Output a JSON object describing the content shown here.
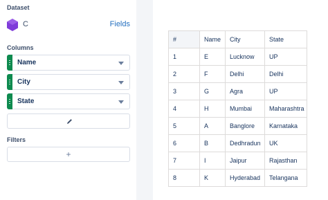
{
  "sidebar": {
    "dataset_label": "Dataset",
    "dataset_name": "C",
    "fields_link": "Fields",
    "columns_label": "Columns",
    "columns": [
      {
        "label": "Name"
      },
      {
        "label": "City"
      },
      {
        "label": "State"
      }
    ],
    "filters_label": "Filters",
    "add_filter": "+"
  },
  "colors": {
    "dataset_icon": "#7f3cd9",
    "column_grip": "#0e8a4f",
    "link": "#2570c0"
  },
  "table": {
    "headers": [
      "#",
      "Name",
      "City",
      "State"
    ],
    "rows": [
      [
        "1",
        "E",
        "Lucknow",
        "UP"
      ],
      [
        "2",
        "F",
        "Delhi",
        "Delhi"
      ],
      [
        "3",
        "G",
        "Agra",
        "UP"
      ],
      [
        "4",
        "H",
        "Mumbai",
        "Maharashtra"
      ],
      [
        "5",
        "A",
        "Banglore",
        "Karnataka"
      ],
      [
        "6",
        "B",
        "Dedhradun",
        "UK"
      ],
      [
        "7",
        "I",
        "Jaipur",
        "Rajasthan"
      ],
      [
        "8",
        "K",
        "Hyderabad",
        "Telangana"
      ]
    ]
  }
}
